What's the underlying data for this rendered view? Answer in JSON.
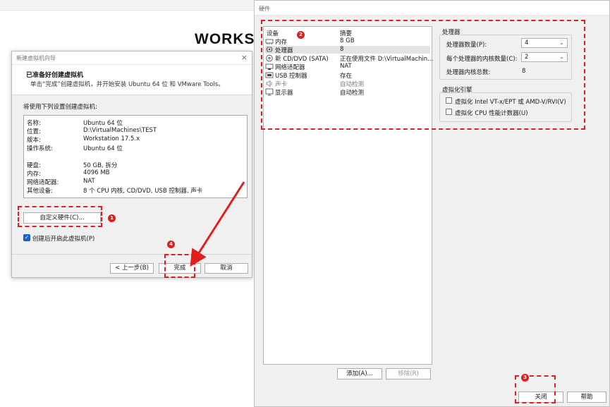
{
  "background": {
    "title": "WORKST"
  },
  "wizard": {
    "title": "新建虚拟机向导",
    "close_glyph": "×",
    "header_title": "已准备好创建虚拟机",
    "header_desc": "单击“完成”创建虚拟机，并开始安装 Ubuntu 64 位 和 VMware Tools。",
    "summary_label": "将使用下列设置创建虚拟机:",
    "summary_rows": [
      {
        "key": "名称:",
        "value": "Ubuntu 64 位"
      },
      {
        "key": "位置:",
        "value": "D:\\VirtualMachines\\TEST"
      },
      {
        "key": "版本:",
        "value": "Workstation 17.5.x"
      },
      {
        "key": "操作系统:",
        "value": "Ubuntu 64 位"
      },
      {
        "key": "硬盘:",
        "value": "50 GB, 拆分"
      },
      {
        "key": "内存:",
        "value": "4096 MB"
      },
      {
        "key": "网络适配器:",
        "value": "NAT"
      },
      {
        "key": "其他设备:",
        "value": "8 个 CPU 内核, CD/DVD, USB 控制器, 声卡"
      }
    ],
    "customize_button": "自定义硬件(C)...",
    "power_on_checkbox": "创建后开启此虚拟机(P)",
    "back_button": "< 上一步(B)",
    "finish_button": "完成",
    "cancel_button": "取消"
  },
  "hardware": {
    "title": "硬件",
    "col_device": "设备",
    "col_summary": "摘要",
    "devices": [
      {
        "name": "内存",
        "summary": "8 GB",
        "icon": "memory-icon"
      },
      {
        "name": "处理器",
        "summary": "8",
        "icon": "processor-icon"
      },
      {
        "name": "新 CD/DVD (SATA)",
        "summary": "正在使用文件 D:\\VirtualMachin...",
        "icon": "cd-dvd-icon"
      },
      {
        "name": "网络适配器",
        "summary": "NAT",
        "icon": "network-icon"
      },
      {
        "name": "USB 控制器",
        "summary": "存在",
        "icon": "usb-icon"
      },
      {
        "name": "声卡",
        "summary": "自动检测",
        "icon": "speaker-icon"
      },
      {
        "name": "显示器",
        "summary": "自动检测",
        "icon": "monitor-icon"
      }
    ],
    "processor_group": "处理器",
    "processor_count_label": "处理器数量(P):",
    "processor_count_value": "4",
    "cores_label": "每个处理器的内核数量(C):",
    "cores_value": "2",
    "total_label": "处理器内核总数:",
    "total_value": "8",
    "virt_group": "虚拟化引擎",
    "virt_option1": "虚拟化 Intel VT-x/EPT 或 AMD-V/RVI(V)",
    "virt_option2": "虚拟化 CPU 性能计数器(U)",
    "add_button": "添加(A)...",
    "remove_button": "移除(R)",
    "close_button": "关闭",
    "help_button": "帮助"
  },
  "annotations": {
    "badge1": "1",
    "badge2": "2",
    "badge3": "3",
    "badge4": "4",
    "color": "#e01e1e"
  }
}
